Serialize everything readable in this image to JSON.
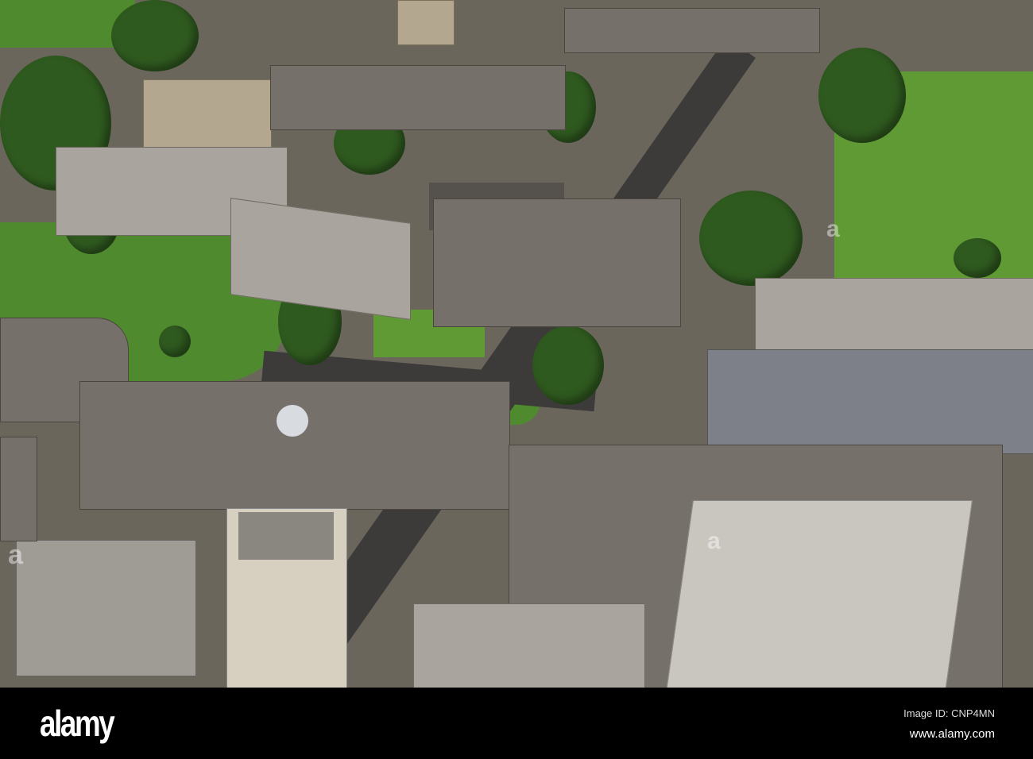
{
  "footer": {
    "logo": "alamy",
    "image_id": "Image ID: CNP4MN",
    "website": "www.alamy.com"
  }
}
